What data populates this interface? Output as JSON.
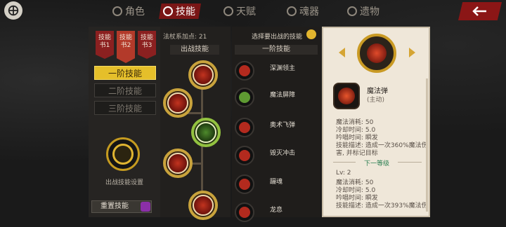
{
  "tabs": [
    {
      "label": "角色",
      "icon": "character-icon",
      "active": false
    },
    {
      "label": "技能",
      "icon": "skill-icon",
      "active": true
    },
    {
      "label": "天赋",
      "icon": "talent-icon",
      "active": false
    },
    {
      "label": "魂器",
      "icon": "soul-vessel-icon",
      "active": false
    },
    {
      "label": "遗物",
      "icon": "relic-icon",
      "active": false
    }
  ],
  "left_panel": {
    "books": [
      "技能书1",
      "技能书2",
      "技能书3"
    ],
    "tiers": [
      "一阶技能",
      "二阶技能",
      "三阶技能"
    ],
    "equip_label": "出战技能设置",
    "reset_label": "重置技能"
  },
  "tree": {
    "points_label": "法杖系加点: 21",
    "column_header": "出战技能"
  },
  "list": {
    "select_hint": "选择要出战的技能",
    "column_header": "一阶技能",
    "skills": [
      "深渊领主",
      "魔法屏障",
      "奥术飞弹",
      "毁灭冲击",
      "蹑魂",
      "龙息"
    ]
  },
  "detail": {
    "skill_name": "魔法弹",
    "skill_type": "(主动)",
    "current": {
      "mana": "魔法消耗: 50",
      "cooldown": "冷却时间: 5.0",
      "cast": "吟唱时间: 瞬发",
      "desc1": "技能描述: 造成一次360%魔法伤",
      "desc2": "害, 并标记目标"
    },
    "next_label": "下一等级",
    "next": {
      "level": "Lv: 2",
      "mana": "魔法消耗: 50",
      "cooldown": "冷却时间: 5.0",
      "cast": "吟唱时间: 瞬发",
      "desc1": "技能描述: 造成一次393%魔法伤"
    }
  },
  "colors": {
    "accent_red": "#7a1616",
    "gold": "#e5bf2a",
    "green": "#93c240"
  }
}
